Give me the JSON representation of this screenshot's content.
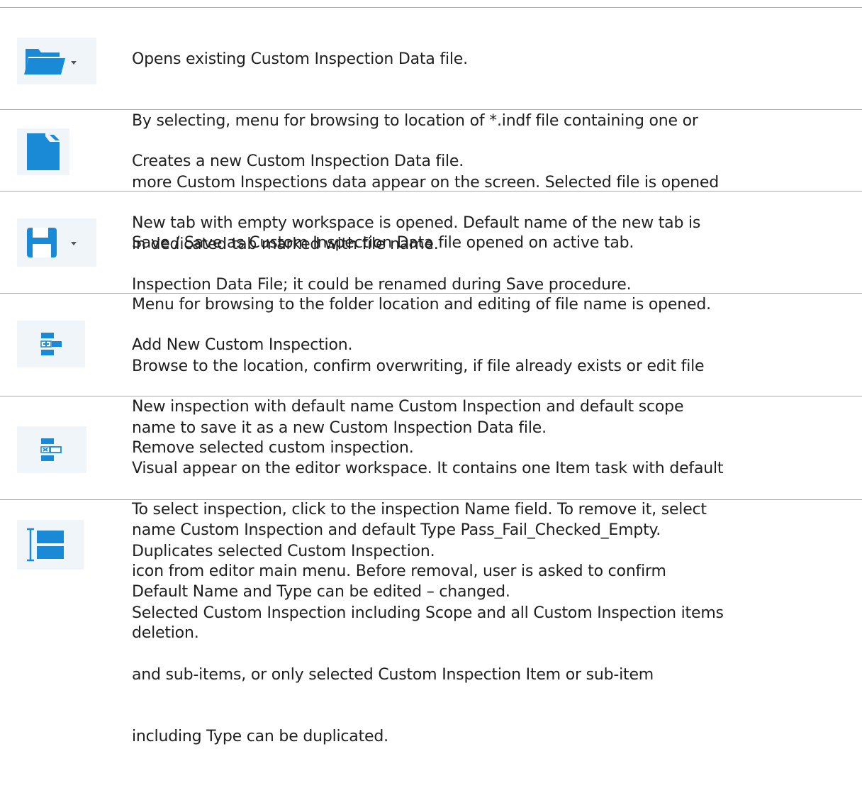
{
  "rows": [
    {
      "icon": "open-folder-dropdown-icon",
      "lines": [
        "Opens existing Custom Inspection Data file.",
        "By selecting, menu for browsing to location of *.indf file containing one or",
        "more Custom Inspections data appear on the screen. Selected file is opened",
        "in dedicated tab marked with file name."
      ]
    },
    {
      "icon": "new-file-icon",
      "lines": [
        "Creates a new Custom Inspection Data file.",
        "New tab with empty workspace is opened. Default name of the new tab is",
        "Inspection Data File; it could be renamed during Save procedure."
      ]
    },
    {
      "icon": "save-dropdown-icon",
      "lines": [
        "Save / Save as Custom Inspection Data file opened on active tab.",
        "Menu for browsing to the folder location and editing of file name is opened.",
        "Browse to the location, confirm overwriting, if file already exists or edit file",
        "name to save it as a new Custom Inspection Data file."
      ]
    },
    {
      "icon": "add-inspection-icon",
      "lines": [
        "Add New Custom Inspection.",
        "New inspection with default name Custom Inspection and default scope",
        "Visual appear on the editor workspace. It contains one Item task with default",
        "name Custom Inspection and default Type Pass_Fail_Checked_Empty.",
        "Default Name and Type can be edited – changed."
      ]
    },
    {
      "icon": "remove-inspection-icon",
      "lines": [
        "Remove selected custom inspection.",
        "To select inspection, click to the inspection Name field. To remove it, select",
        "icon from editor main menu. Before removal, user is asked to confirm",
        "deletion."
      ]
    },
    {
      "icon": "duplicate-inspection-icon",
      "lines": [
        "Duplicates selected Custom Inspection.",
        "Selected Custom Inspection including Scope and all Custom Inspection items",
        "and sub-items, or only selected Custom Inspection Item or sub-item",
        "including Type can be duplicated."
      ]
    }
  ],
  "colors": {
    "icon_blue": "#1a8ad6",
    "icon_bg": "#f0f5fa",
    "rule": "#a9a9a9"
  }
}
